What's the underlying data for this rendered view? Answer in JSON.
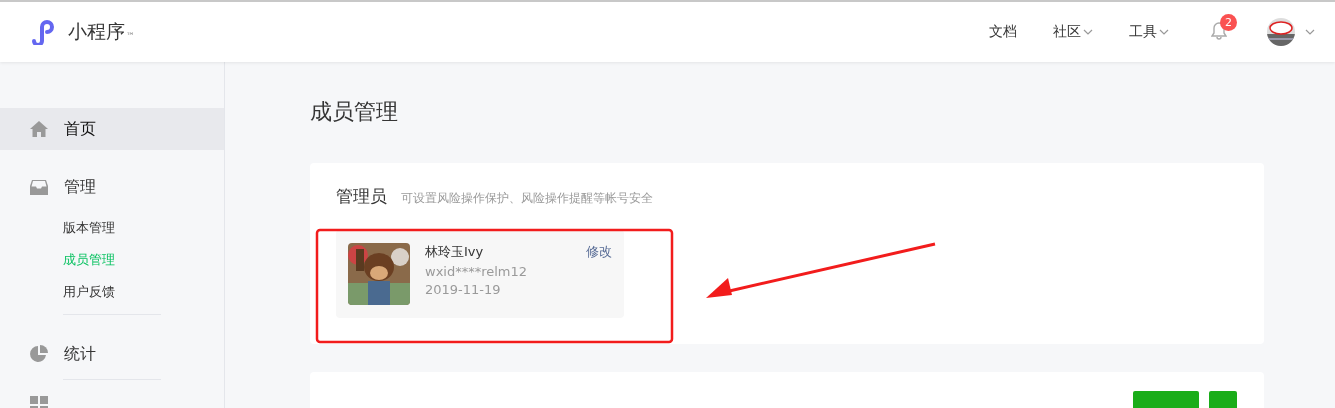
{
  "header": {
    "logo_text": "小程序",
    "trademark": "™",
    "nav": [
      {
        "label": "文档",
        "dropdown": false
      },
      {
        "label": "社区",
        "dropdown": true
      },
      {
        "label": "工具",
        "dropdown": true
      }
    ],
    "notification_count": "2"
  },
  "sidebar": {
    "items": [
      {
        "label": "首页",
        "selected": true
      },
      {
        "label": "管理",
        "selected": false,
        "children": [
          {
            "label": "版本管理",
            "selected": false
          },
          {
            "label": "成员管理",
            "selected": true
          },
          {
            "label": "用户反馈",
            "selected": false
          }
        ]
      },
      {
        "label": "统计",
        "selected": false
      },
      {
        "selected": false
      }
    ]
  },
  "page_title": "成员管理",
  "admin_card": {
    "title": "管理员",
    "hint": "可设置风险操作保护、风险操作提醒等帐号安全",
    "member": {
      "kind": "picture",
      "name": "林玲玉Ivy",
      "wxid": "wxid****relm12",
      "date": "2019-11-19",
      "action": "修改"
    }
  },
  "annotation": {
    "highlight": true,
    "arrow": true
  }
}
